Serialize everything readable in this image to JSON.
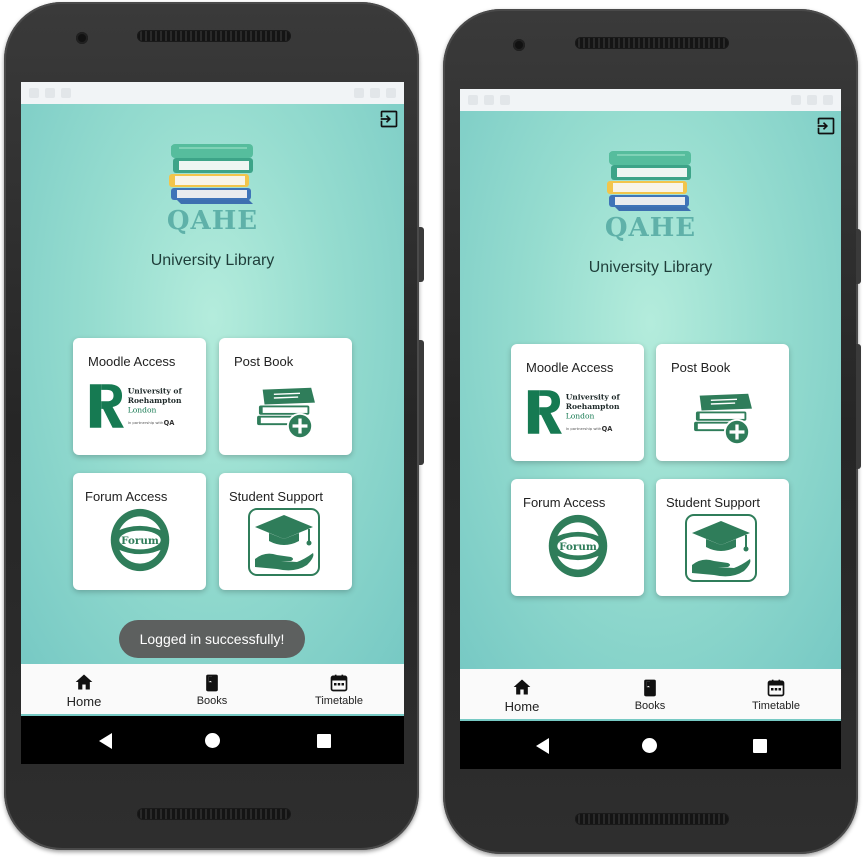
{
  "app": {
    "brand": "QAHE",
    "title": "University Library"
  },
  "cards": [
    {
      "label": "Moodle Access",
      "icon": "roehampton-logo-icon",
      "logo_text": {
        "line1": "University of",
        "line2": "Roehampton",
        "line3": "London",
        "tagline": "In partnership with",
        "partner": "QA"
      }
    },
    {
      "label": "Post Book",
      "icon": "book-stack-add-icon"
    },
    {
      "label": "Forum Access",
      "icon": "forum-logo-icon",
      "logo_text": "Forum"
    },
    {
      "label": "Student Support",
      "icon": "graduation-cap-hand-icon"
    }
  ],
  "toast": "Logged in successfully!",
  "bottom_nav": [
    {
      "label": "Home",
      "icon": "home-icon",
      "active": true
    },
    {
      "label": "Books",
      "icon": "book-icon",
      "active": false
    },
    {
      "label": "Timetable",
      "icon": "calendar-icon",
      "active": false
    }
  ],
  "colors": {
    "accent": "#2f7d5a",
    "brand_text": "#5fb1a9",
    "background": "#95dccf",
    "toast": "#5d605f"
  }
}
